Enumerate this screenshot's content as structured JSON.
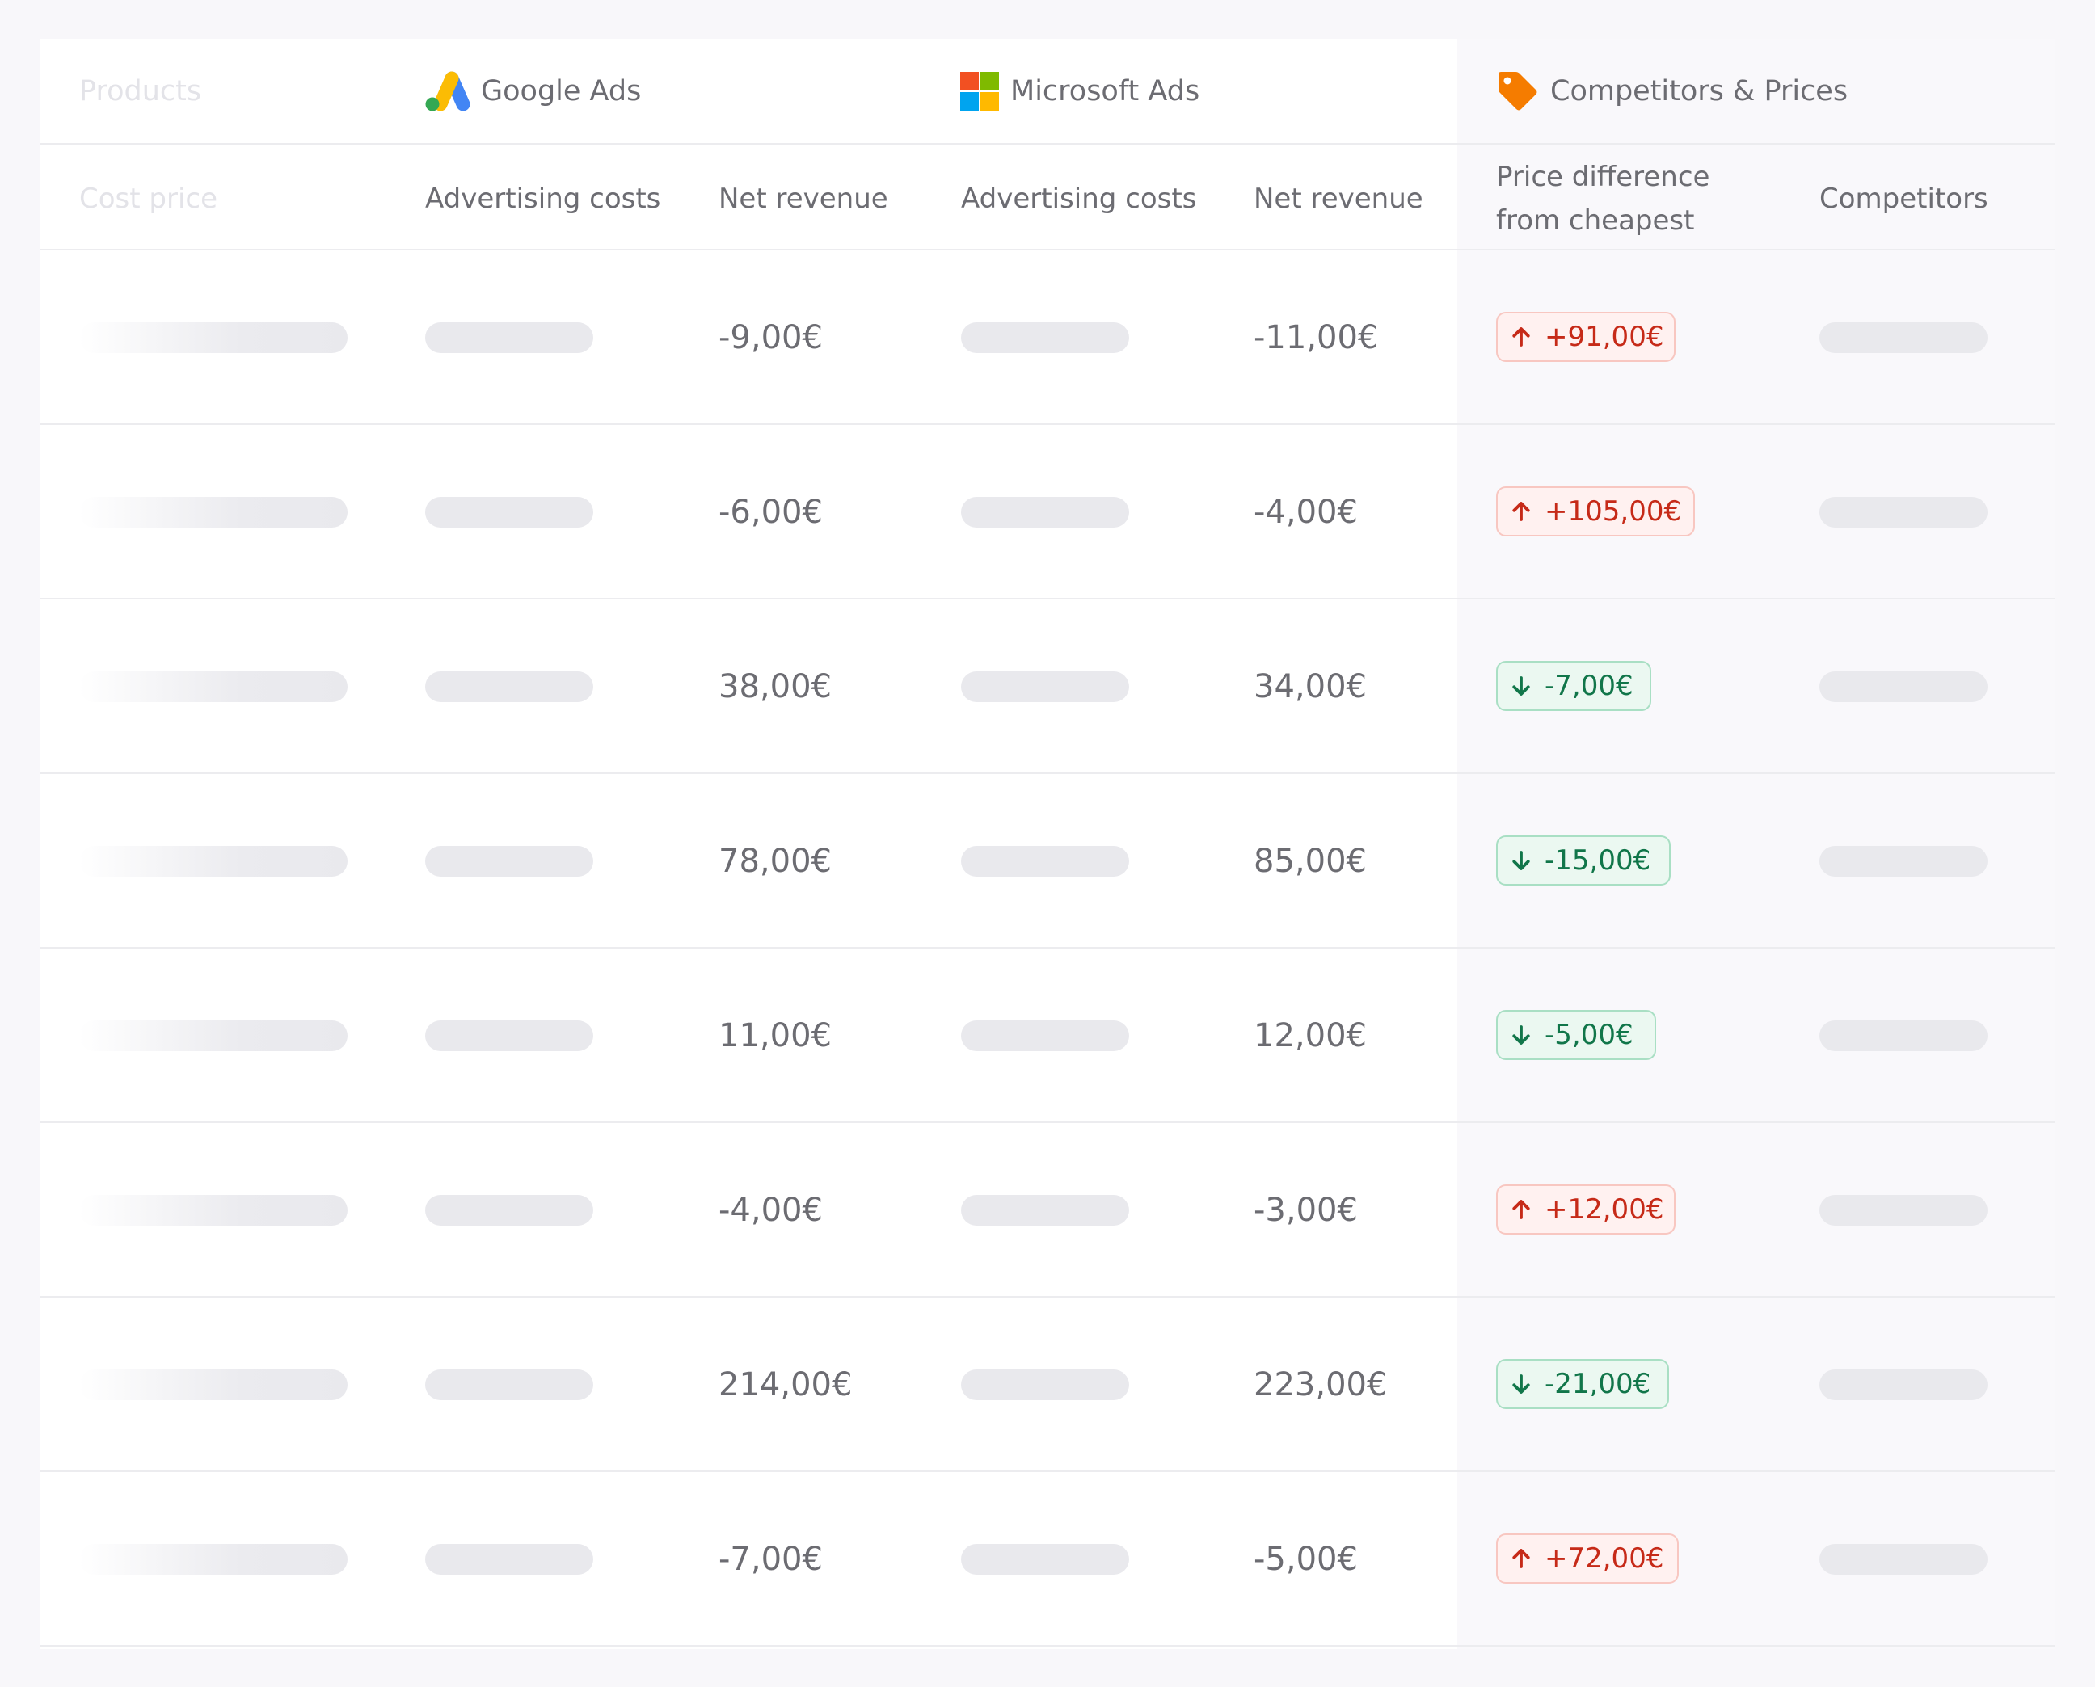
{
  "groups": {
    "products": "Products",
    "google_ads": "Google Ads",
    "microsoft_ads": "Microsoft Ads",
    "competitors": "Competitors & Prices"
  },
  "columns": {
    "cost_price": "Cost price",
    "google_advertising_costs": "Advertising costs",
    "google_net_revenue": "Net revenue",
    "microsoft_advertising_costs": "Advertising costs",
    "microsoft_net_revenue": "Net revenue",
    "price_difference_line1": "Price difference",
    "price_difference_line2": "from cheapest",
    "competitors": "Competitors"
  },
  "colors": {
    "increase": "#c62a18",
    "decrease": "#11764a",
    "google_blue": "#4285F4",
    "google_yellow": "#FBBC04",
    "google_green": "#34A853",
    "ms_red": "#F25022",
    "ms_green": "#7FBA00",
    "ms_blue": "#00A4EF",
    "ms_yellow": "#FFB900",
    "tag_orange": "#F57C00"
  },
  "icons": {
    "google_ads": "google-ads-logo",
    "microsoft_ads": "microsoft-logo",
    "competitors": "price-tag",
    "increase": "arrow-up",
    "decrease": "arrow-down"
  },
  "rows": [
    {
      "google_net_revenue": "-9,00€",
      "microsoft_net_revenue": "-11,00€",
      "price_diff": "+91,00€",
      "direction": "up"
    },
    {
      "google_net_revenue": "-6,00€",
      "microsoft_net_revenue": "-4,00€",
      "price_diff": "+105,00€",
      "direction": "up"
    },
    {
      "google_net_revenue": "38,00€",
      "microsoft_net_revenue": "34,00€",
      "price_diff": "-7,00€",
      "direction": "down"
    },
    {
      "google_net_revenue": "78,00€",
      "microsoft_net_revenue": "85,00€",
      "price_diff": "-15,00€",
      "direction": "down"
    },
    {
      "google_net_revenue": "11,00€",
      "microsoft_net_revenue": "12,00€",
      "price_diff": "-5,00€",
      "direction": "down"
    },
    {
      "google_net_revenue": "-4,00€",
      "microsoft_net_revenue": "-3,00€",
      "price_diff": "+12,00€",
      "direction": "up"
    },
    {
      "google_net_revenue": "214,00€",
      "microsoft_net_revenue": "223,00€",
      "price_diff": "-21,00€",
      "direction": "down"
    },
    {
      "google_net_revenue": "-7,00€",
      "microsoft_net_revenue": "-5,00€",
      "price_diff": "+72,00€",
      "direction": "up"
    }
  ]
}
